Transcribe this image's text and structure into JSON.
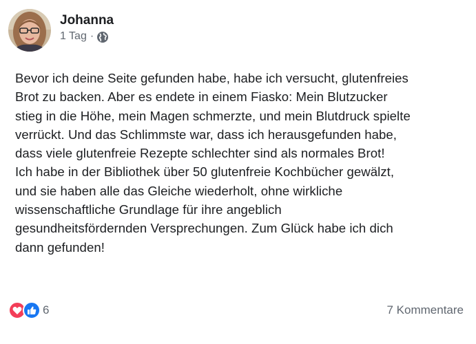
{
  "post": {
    "author": "Johanna",
    "time": "1 Tag",
    "separator": "·",
    "privacy_icon": "globe-icon",
    "text": "Bevor ich deine Seite gefunden habe, habe ich versucht, glutenfreies\nBrot zu backen. Aber es endete in einem Fiasko: Mein Blutzucker\nstieg in die Höhe, mein Magen schmerzte, und mein Blutdruck spielte\nverrückt. Und das Schlimmste war, dass ich herausgefunden habe,\ndass viele glutenfreie Rezepte schlechter sind als normales Brot!\nIch habe in der Bibliothek über 50 glutenfreie Kochbücher gewälzt,\nund sie haben alle das Gleiche wiederholt, ohne wirkliche\nwissenschaftliche Grundlage für ihre angeblich\ngesundheitsfördernden Versprechungen. Zum Glück habe ich dich\ndann gefunden!"
  },
  "footer": {
    "reaction_icons": [
      "heart-icon",
      "thumbs-up-icon"
    ],
    "reaction_count": "6",
    "comments_label": "7 Kommentare"
  },
  "colors": {
    "love": "#f33e58",
    "like": "#1877f2",
    "muted": "#606770",
    "text": "#1c1e21"
  }
}
